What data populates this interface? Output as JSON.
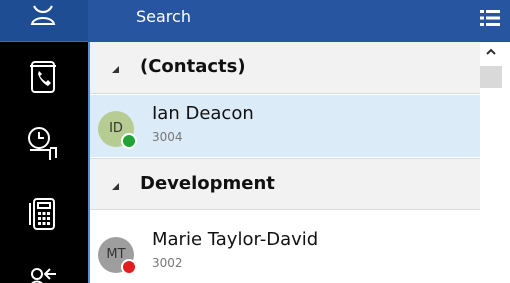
{
  "header": {
    "search_label": "Search"
  },
  "sidebar": {
    "items": [
      {
        "icon": "user-icon"
      },
      {
        "icon": "phonebook-icon"
      },
      {
        "icon": "call-history-icon"
      },
      {
        "icon": "dialpad-icon"
      },
      {
        "icon": "logout-icon"
      }
    ]
  },
  "groups": [
    {
      "label": "(Contacts)"
    },
    {
      "label": "Development"
    }
  ],
  "contacts": [
    {
      "initials": "ID",
      "name": "Ian Deacon",
      "ext": "3004",
      "status": "available",
      "status_color": "#21a336",
      "avatar_color": "#b7cc92",
      "selected": true
    },
    {
      "initials": "MT",
      "name": "Marie Taylor-David",
      "ext": "3002",
      "status": "busy",
      "status_color": "#e01e1e",
      "avatar_color": "#9e9e9e",
      "selected": false
    }
  ],
  "colors": {
    "header": "#2855a0",
    "sidebar": "#000000",
    "selected_row": "#dcebf8"
  }
}
